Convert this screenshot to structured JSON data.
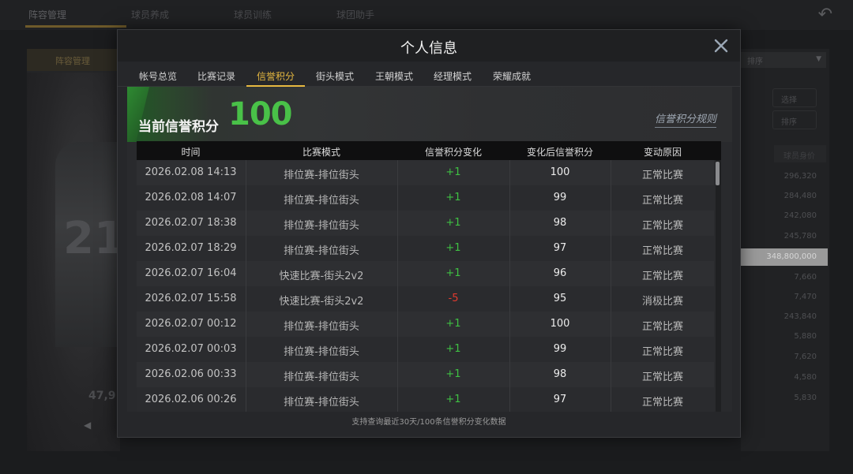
{
  "background": {
    "tabs": [
      "阵容管理",
      "球员养成",
      "球员训练",
      "球团助手"
    ],
    "left_head": "阵容管理",
    "player_number": "21",
    "player_value": "47,9",
    "right_dropdown": "排序",
    "right_buttons": [
      "选择",
      "排序"
    ],
    "right_head": "球员身价",
    "right_values": [
      "296,320",
      "284,480",
      "242,080",
      "245,780"
    ],
    "right_highlight": "348,800,000",
    "right_values_2": [
      "7,660",
      "7,470",
      "243,840",
      "5,880",
      "7,620",
      "4,580",
      "5,830"
    ]
  },
  "modal": {
    "title": "个人信息",
    "tabs": [
      {
        "label": "帐号总览"
      },
      {
        "label": "比赛记录"
      },
      {
        "label": "信誉积分"
      },
      {
        "label": "街头模式"
      },
      {
        "label": "王朝模式"
      },
      {
        "label": "经理模式"
      },
      {
        "label": "荣耀成就"
      }
    ],
    "active_tab": "信誉积分",
    "banner": {
      "label": "当前信誉积分",
      "score": "100",
      "rules_link": "信誉积分规则"
    },
    "table": {
      "headers": [
        "时间",
        "比赛模式",
        "信誉积分变化",
        "变化后信誉积分",
        "变动原因"
      ],
      "rows": [
        {
          "time": "2026.02.08  14:13",
          "mode": "排位赛-排位街头",
          "change": "+1",
          "after": "100",
          "reason": "正常比赛"
        },
        {
          "time": "2026.02.08  14:07",
          "mode": "排位赛-排位街头",
          "change": "+1",
          "after": "99",
          "reason": "正常比赛"
        },
        {
          "time": "2026.02.07  18:38",
          "mode": "排位赛-排位街头",
          "change": "+1",
          "after": "98",
          "reason": "正常比赛"
        },
        {
          "time": "2026.02.07  18:29",
          "mode": "排位赛-排位街头",
          "change": "+1",
          "after": "97",
          "reason": "正常比赛"
        },
        {
          "time": "2026.02.07  16:04",
          "mode": "快速比赛-街头2v2",
          "change": "+1",
          "after": "96",
          "reason": "正常比赛"
        },
        {
          "time": "2026.02.07  15:58",
          "mode": "快速比赛-街头2v2",
          "change": "-5",
          "after": "95",
          "reason": "消极比赛"
        },
        {
          "time": "2026.02.07  00:12",
          "mode": "排位赛-排位街头",
          "change": "+1",
          "after": "100",
          "reason": "正常比赛"
        },
        {
          "time": "2026.02.07  00:03",
          "mode": "排位赛-排位街头",
          "change": "+1",
          "after": "99",
          "reason": "正常比赛"
        },
        {
          "time": "2026.02.06  00:33",
          "mode": "排位赛-排位街头",
          "change": "+1",
          "after": "98",
          "reason": "正常比赛"
        },
        {
          "time": "2026.02.06  00:26",
          "mode": "排位赛-排位街头",
          "change": "+1",
          "after": "97",
          "reason": "正常比赛"
        }
      ]
    },
    "footer_note": "支持查询最近30天/100条信誉积分变化数据"
  },
  "colors": {
    "accent": "#e7b940",
    "positive": "#3fc043",
    "negative": "#e23a2e",
    "score": "#49c148"
  }
}
